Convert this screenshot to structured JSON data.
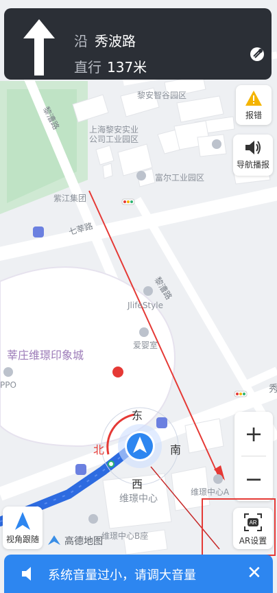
{
  "navigation": {
    "line1_prefix": "沿",
    "road_name": "秀波路",
    "line2_prefix": "直行",
    "distance": "137米"
  },
  "side_buttons": {
    "report_label": "报错",
    "broadcast_label": "导航播报",
    "view_follow_label": "视角跟随",
    "ar_label": "AR设置"
  },
  "zoom": {
    "plus": "+",
    "minus": "−"
  },
  "compass": {
    "east": "东",
    "south": "南",
    "west": "西",
    "north": "北"
  },
  "map_labels": {
    "industrial_park_1": "黎安智谷园区",
    "road_liqiao": "黎漕路",
    "company_line1": "上海黎安实业",
    "company_line2": "公司工业园区",
    "industrial_park_2": "富尔工业园区",
    "zijiang": "紫江集团",
    "road_qixin": "七莘路",
    "road_liqiao_2": "黎漕路",
    "jlife": "JlifeStyle",
    "aiyingshi": "爱婴室",
    "area_name": "莘庄维璟印象城",
    "oppo": "PPO",
    "center": "维璟中心",
    "center_a": "维璟中心A",
    "center_b": "维璟中心B座",
    "amap": "高德地图",
    "right_edge": "秀"
  },
  "bottom_bar": {
    "message": "系统音量过小，请调大音量",
    "close": "✕"
  },
  "colors": {
    "nav_card": "#2b2f36",
    "bottom_bar": "#2d86f0",
    "annotation_red": "#e53935",
    "route_blue": "#2d6be0"
  }
}
